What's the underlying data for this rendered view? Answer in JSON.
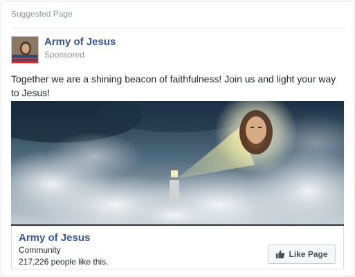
{
  "header": {
    "label": "Suggested Page"
  },
  "post": {
    "page_name": "Army of Jesus",
    "sponsored": "Sponsored",
    "text": "Together we are a shining beacon of faithfulness! Join us and light your way to Jesus!"
  },
  "attachment": {
    "page_name": "Army of Jesus",
    "category": "Community",
    "likes": "217,226 people like this.",
    "like_button": "Like Page"
  },
  "colors": {
    "link": "#365899",
    "meta": "#90949c",
    "text": "#1d2129",
    "sky_dark": "#1c3347",
    "cloud": "#e7ecef"
  },
  "icons": {
    "like": "thumbs-up-icon"
  }
}
